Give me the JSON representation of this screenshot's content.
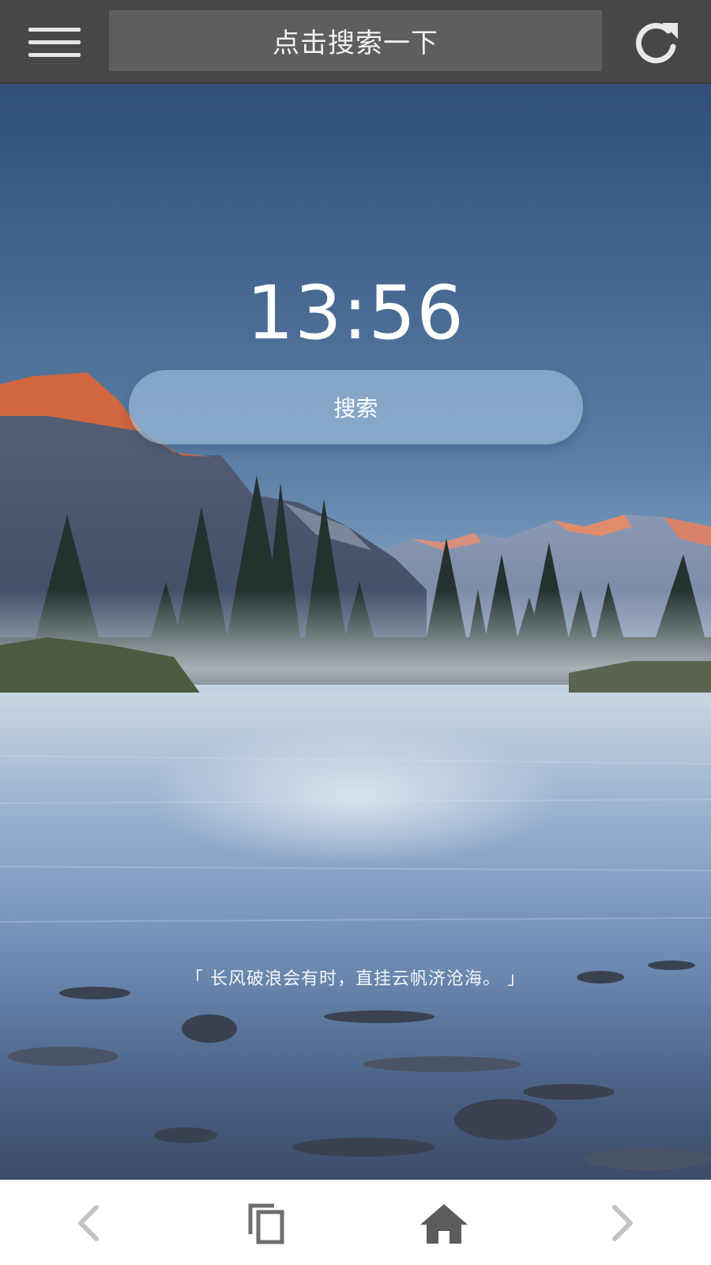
{
  "header": {
    "search_placeholder": "点击搜索一下",
    "menu_icon": "hamburger-menu-icon",
    "refresh_icon": "refresh-icon"
  },
  "main": {
    "time": "13:56",
    "search_button_label": "搜索",
    "quote": "「 长风破浪会有时，直挂云帆济沧海。 」"
  },
  "bottom_nav": {
    "items": [
      {
        "name": "back",
        "icon": "chevron-left-icon"
      },
      {
        "name": "tabs",
        "icon": "tabs-icon"
      },
      {
        "name": "home",
        "icon": "home-icon"
      },
      {
        "name": "forward",
        "icon": "chevron-right-icon"
      }
    ]
  },
  "colors": {
    "topbar_bg": "#474747",
    "searchbox_bg": "#5e5e5e",
    "nav_icon_inactive": "#c3c3c3",
    "nav_icon_active": "#5c5c5c"
  }
}
